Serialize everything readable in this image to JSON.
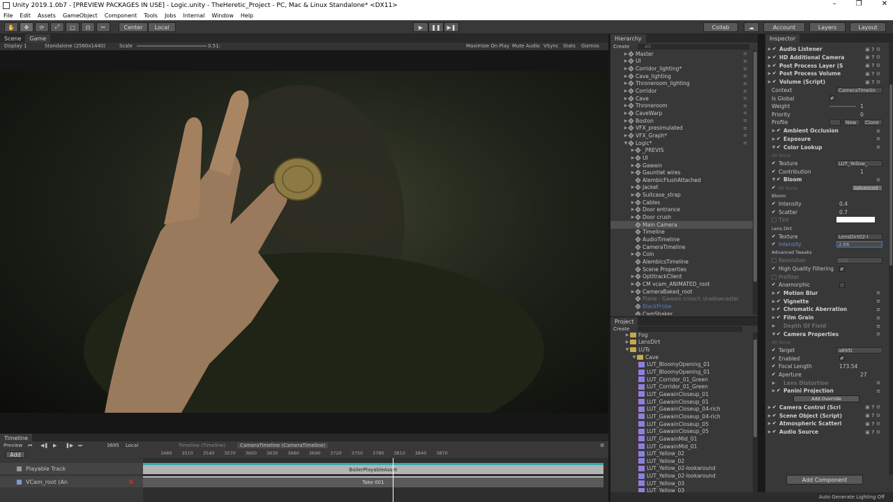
{
  "window": {
    "title": "Unity 2019.1.0b7 - [PREVIEW PACKAGES IN USE] - Logic.unity - TheHeretic_Project - PC, Mac & Linux Standalone* <DX11>"
  },
  "menu": [
    "File",
    "Edit",
    "Assets",
    "GameObject",
    "Component",
    "Tools",
    "Jobs",
    "Internal",
    "Window",
    "Help"
  ],
  "toolbar": {
    "center": "Center",
    "local": "Local",
    "collab": "Collab",
    "account": "Account",
    "layers": "Layers",
    "layout": "Layout"
  },
  "game": {
    "tabs": [
      "Scene",
      "Game"
    ],
    "display": "Display 1",
    "resolution": "Standalone (2560x1440)",
    "scale_label": "Scale",
    "scale_value": "0.51:",
    "maximize": "Maximize On Play",
    "mute": "Mute Audio",
    "vsync": "VSync",
    "stats": "Stats",
    "gizmos": "Gizmos"
  },
  "timeline": {
    "tab": "Timeline",
    "preview": "Preview",
    "frame": "3695",
    "local": "Local",
    "crumb1": "Timeline (Timeline)",
    "crumb2": "CameraTimeline (CameraTimeline)",
    "add": "Add",
    "tracks": [
      {
        "name": "Playable Track",
        "clip": "BoilerPlayableAsset"
      },
      {
        "name": "VCam_root (An",
        "clip": "Take 001"
      }
    ],
    "ticks": [
      "3480",
      "3510",
      "3540",
      "3570",
      "3600",
      "3630",
      "3660",
      "3690",
      "3720",
      "3750",
      "3780",
      "3810",
      "3840",
      "3870"
    ]
  },
  "hierarchy": {
    "tab": "Hierarchy",
    "create": "Create",
    "search": "All",
    "items": [
      {
        "t": "Master",
        "d": 1,
        "type": "go"
      },
      {
        "t": "UI",
        "d": 1,
        "type": "go"
      },
      {
        "t": "Corridor_lighting*",
        "d": 1,
        "type": "go"
      },
      {
        "t": "Cave_lighting",
        "d": 1,
        "type": "go"
      },
      {
        "t": "Throneroom_lighting",
        "d": 1,
        "type": "go"
      },
      {
        "t": "Corridor",
        "d": 1,
        "type": "go"
      },
      {
        "t": "Cave",
        "d": 1,
        "type": "go"
      },
      {
        "t": "Throneroom",
        "d": 1,
        "type": "go"
      },
      {
        "t": "CaveWarp",
        "d": 1,
        "type": "go"
      },
      {
        "t": "Boston",
        "d": 1,
        "type": "go"
      },
      {
        "t": "VFX_presimulated",
        "d": 1,
        "type": "go"
      },
      {
        "t": "VFX_Graph*",
        "d": 1,
        "type": "go"
      },
      {
        "t": "Logic*",
        "d": 1,
        "type": "open"
      },
      {
        "t": "_PREVIS",
        "d": 2,
        "type": "go"
      },
      {
        "t": "UI",
        "d": 2,
        "type": "go"
      },
      {
        "t": "Gawain",
        "d": 2,
        "type": "go"
      },
      {
        "t": "Gauntlet wires",
        "d": 2,
        "type": "go"
      },
      {
        "t": "AlembicFlushAttached",
        "d": 2,
        "type": "leaf"
      },
      {
        "t": "Jacket",
        "d": 2,
        "type": "go"
      },
      {
        "t": "Suitcase_strap",
        "d": 2,
        "type": "go"
      },
      {
        "t": "Cables",
        "d": 2,
        "type": "go"
      },
      {
        "t": "Door entrance",
        "d": 2,
        "type": "go"
      },
      {
        "t": "Door crush",
        "d": 2,
        "type": "go"
      },
      {
        "t": "Main Camera",
        "d": 2,
        "type": "sel"
      },
      {
        "t": "Timeline",
        "d": 2,
        "type": "leaf"
      },
      {
        "t": "AudioTimeline",
        "d": 2,
        "type": "leaf"
      },
      {
        "t": "CameraTimeline",
        "d": 2,
        "type": "leaf"
      },
      {
        "t": "Coin",
        "d": 2,
        "type": "go"
      },
      {
        "t": "AlembicsTimeline",
        "d": 2,
        "type": "leaf"
      },
      {
        "t": "Scene Properties",
        "d": 2,
        "type": "leaf"
      },
      {
        "t": "OptitrackClient",
        "d": 2,
        "type": "go"
      },
      {
        "t": "CM vcam_ANIMATED_root",
        "d": 2,
        "type": "go"
      },
      {
        "t": "CameraBaked_root",
        "d": 2,
        "type": "go"
      },
      {
        "t": "Plane - Gawain crouch shadowcaster",
        "d": 2,
        "type": "dim"
      },
      {
        "t": "BlackProbe",
        "d": 2,
        "type": "blue"
      },
      {
        "t": "CamShaker",
        "d": 2,
        "type": "leaf"
      }
    ]
  },
  "project": {
    "tab": "Project",
    "create": "Create",
    "items": [
      {
        "t": "Fog",
        "d": 2,
        "type": "folder"
      },
      {
        "t": "LensDirt",
        "d": 2,
        "type": "folder"
      },
      {
        "t": "LUTs",
        "d": 2,
        "type": "openfolder"
      },
      {
        "t": "Cave",
        "d": 3,
        "type": "openfolder"
      },
      {
        "t": "LUT_BloomyOpening_01",
        "d": 4,
        "type": "lut"
      },
      {
        "t": "LUT_BloomyOpening_01",
        "d": 4,
        "type": "lut"
      },
      {
        "t": "LUT_Corridor_01_Green",
        "d": 4,
        "type": "lut"
      },
      {
        "t": "LUT_Corridor_01_Green",
        "d": 4,
        "type": "lut"
      },
      {
        "t": "LUT_GawainCloseup_01",
        "d": 4,
        "type": "lut"
      },
      {
        "t": "LUT_GawainCloseup_01",
        "d": 4,
        "type": "lut"
      },
      {
        "t": "LUT_GawainCloseup_04-rich",
        "d": 4,
        "type": "lut"
      },
      {
        "t": "LUT_GawainCloseup_04-rich",
        "d": 4,
        "type": "lut"
      },
      {
        "t": "LUT_GawainCloseup_05",
        "d": 4,
        "type": "lut"
      },
      {
        "t": "LUT_GawainCloseup_05",
        "d": 4,
        "type": "lut"
      },
      {
        "t": "LUT_GawainMid_01",
        "d": 4,
        "type": "lut"
      },
      {
        "t": "LUT_GawainMid_01",
        "d": 4,
        "type": "lut"
      },
      {
        "t": "LUT_Yellow_02",
        "d": 4,
        "type": "lut"
      },
      {
        "t": "LUT_Yellow_02",
        "d": 4,
        "type": "lut"
      },
      {
        "t": "LUT_Yellow_02-lookaround",
        "d": 4,
        "type": "lut"
      },
      {
        "t": "LUT_Yellow_02-lookaround",
        "d": 4,
        "type": "lut"
      },
      {
        "t": "LUT_Yellow_03",
        "d": 4,
        "type": "lut"
      },
      {
        "t": "LUT_Yellow_03",
        "d": 4,
        "type": "lut"
      }
    ]
  },
  "inspector": {
    "tab": "Inspector",
    "add_component": "Add Component",
    "status": "Auto Generate Lighting Off",
    "rows": [
      {
        "t": "Audio Listener",
        "k": "comp"
      },
      {
        "t": "HD Additional Camera",
        "k": "comp"
      },
      {
        "t": "Post Process Layer (S",
        "k": "comp"
      },
      {
        "t": "Post Process Volume",
        "k": "comp"
      },
      {
        "t": "Volume (Script)",
        "k": "comp"
      },
      {
        "t": "Context",
        "k": "field",
        "v": "CameraTimelin"
      },
      {
        "t": "Is Global",
        "k": "check"
      },
      {
        "t": "Weight",
        "k": "val",
        "v": "1"
      },
      {
        "t": "Priority",
        "k": "val",
        "v": "0"
      },
      {
        "t": "Profile",
        "k": "profile",
        "v": "New",
        "v2": "Clone"
      },
      {
        "t": "Ambient Occlusion",
        "k": "section"
      },
      {
        "t": "Exposure",
        "k": "section"
      },
      {
        "t": "Color Lookup",
        "k": "section"
      },
      {
        "t": "All  None",
        "k": "dimsmall"
      },
      {
        "t": "Texture",
        "k": "field",
        "v": "LUT_Yellow_"
      },
      {
        "t": "Contribution",
        "k": "val",
        "v": "1"
      },
      {
        "t": "Bloom",
        "k": "section"
      },
      {
        "t": "All  None",
        "k": "adv",
        "v": "Advanced"
      },
      {
        "t": "Bloom",
        "k": "label"
      },
      {
        "t": "Intensity",
        "k": "val",
        "v": "0.4"
      },
      {
        "t": "Scatter",
        "k": "val",
        "v": "0.7"
      },
      {
        "t": "Tint",
        "k": "tint"
      },
      {
        "t": "Lens Dirt",
        "k": "label"
      },
      {
        "t": "Texture",
        "k": "field",
        "v": "LensDirt02-i"
      },
      {
        "t": "Intensity",
        "k": "active",
        "v": "2.66"
      },
      {
        "t": "Advanced Tweaks",
        "k": "label"
      },
      {
        "t": "Resolution",
        "k": "dimfield",
        "v": "Half"
      },
      {
        "t": "High Quality Filtering",
        "k": "check"
      },
      {
        "t": "Prefilter",
        "k": "dim"
      },
      {
        "t": "Anamorphic",
        "k": "check"
      },
      {
        "t": "Motion Blur",
        "k": "section"
      },
      {
        "t": "Vignette",
        "k": "section"
      },
      {
        "t": "Chromatic Aberration",
        "k": "section"
      },
      {
        "t": "Film Grain",
        "k": "section"
      },
      {
        "t": "Depth Of Field",
        "k": "dimsection"
      },
      {
        "t": "Camera Properties",
        "k": "section"
      },
      {
        "t": "All  None",
        "k": "dimsmall"
      },
      {
        "t": "Target",
        "k": "field",
        "v": "a895("
      },
      {
        "t": "Enabled",
        "k": "check"
      },
      {
        "t": "Focal Length",
        "k": "val",
        "v": "173.54"
      },
      {
        "t": "Aperture",
        "k": "val",
        "v": "27"
      },
      {
        "t": "Lens Distortion",
        "k": "dimsection"
      },
      {
        "t": "Panini Projection",
        "k": "section"
      },
      {
        "t": "Add Override",
        "k": "button"
      },
      {
        "t": "Camera Control (Scri",
        "k": "comp"
      },
      {
        "t": "Scene Object (Script)",
        "k": "comp"
      },
      {
        "t": "Atmospheric Scatteri",
        "k": "comp"
      },
      {
        "t": "Audio Source",
        "k": "comp"
      }
    ]
  }
}
